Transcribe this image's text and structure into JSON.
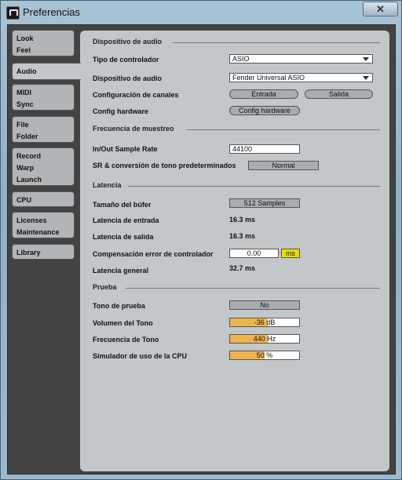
{
  "window": {
    "title": "Preferencias",
    "close_label": "✕"
  },
  "sidebar": {
    "tabs": [
      {
        "lines": [
          "Look",
          "Feel"
        ]
      },
      {
        "lines": [
          "Audio"
        ],
        "active": true
      },
      {
        "lines": [
          "MIDI",
          "Sync"
        ]
      },
      {
        "lines": [
          "File",
          "Folder"
        ]
      },
      {
        "lines": [
          "Record",
          "Warp",
          "Launch"
        ]
      },
      {
        "lines": [
          "CPU"
        ]
      },
      {
        "lines": [
          "Licenses",
          "Maintenance"
        ]
      },
      {
        "lines": [
          "Library"
        ]
      }
    ]
  },
  "audio_device": {
    "section": "Dispositivo de audio",
    "driver_label": "Tipo de controlador",
    "driver_value": "ASIO",
    "device_label": "Dispositivo de audio",
    "device_value": "Fender Universal ASIO",
    "channels_label": "Configuración de canales",
    "input_button": "Entrada",
    "output_button": "Salida",
    "hw_label": "Config hardware",
    "hw_button": "Config hardware"
  },
  "sample_rate": {
    "section": "Frecuencia de muestreo",
    "rate_label": "In/Out Sample Rate",
    "rate_value": "44100",
    "sr_label": "SR & conversión de tono predeterminados",
    "sr_value": "Normal"
  },
  "latency": {
    "section": "Latencia",
    "buffer_label": "Tamaño del búfer",
    "buffer_value": "512 Samples",
    "input_label": "Latencia de entrada",
    "input_value": "16.3 ms",
    "output_label": "Latencia de salida",
    "output_value": "16.3 ms",
    "comp_label": "Compensación error de controlador",
    "comp_value": "0.00",
    "comp_unit": "ms",
    "overall_label": "Latencia general",
    "overall_value": "32.7 ms"
  },
  "test": {
    "section": "Prueba",
    "tone_label": "Tono de prueba",
    "tone_value": "No",
    "volume_label": "Volumen del Tono",
    "volume_value": "-36 dB",
    "volume_level": 0.55,
    "freq_label": "Frecuencia de Tono",
    "freq_value": "440 Hz",
    "freq_level": 0.55,
    "cpu_label": "Simulador de uso de la CPU",
    "cpu_value": "50 %",
    "cpu_level": 0.5
  },
  "colors": {
    "accent_fill": "#f0b44e",
    "unit_badge": "#e8e000",
    "panel": "#c3c7ca"
  }
}
